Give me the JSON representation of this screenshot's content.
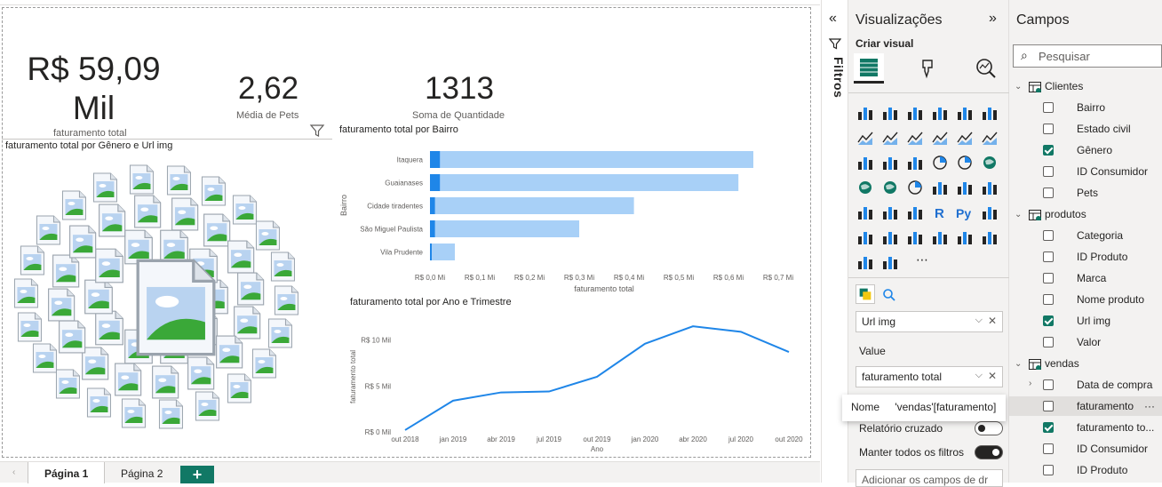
{
  "kpis": {
    "revenue": {
      "value_line1": "R$ 59,09",
      "value_line2": "Mil",
      "caption": "faturamento total"
    },
    "pets": {
      "value": "2,62",
      "caption": "Média de Pets"
    },
    "quantity": {
      "value": "1313",
      "caption": "Soma de Quantidade"
    }
  },
  "visuals": {
    "image_title": "faturamento total por Gênero e Url img",
    "bar_title": "faturamento total por Bairro",
    "line_title": "faturamento total por Ano e Trimestre"
  },
  "chart_data": [
    {
      "type": "bar",
      "orientation": "horizontal",
      "title": "faturamento total por Bairro",
      "xlabel": "faturamento total",
      "ylabel": "Bairro",
      "categories": [
        "Itaquera",
        "Guaianases",
        "Cidade tiradentes",
        "São Miguel Paulista",
        "Vila Prudente"
      ],
      "values": [
        0.65,
        0.62,
        0.41,
        0.3,
        0.05
      ],
      "highlight_values": [
        0.02,
        0.02,
        0.01,
        0.01,
        0.0
      ],
      "unit": "R$ Mi",
      "xlim": [
        0,
        0.7
      ],
      "xticks": [
        "R$ 0,0 Mi",
        "R$ 0,1 Mi",
        "R$ 0,2 Mi",
        "R$ 0,3 Mi",
        "R$ 0,4 Mi",
        "R$ 0,5 Mi",
        "R$ 0,6 Mi",
        "R$ 0,7 Mi"
      ],
      "colors": {
        "bar": "#a8d0f7",
        "highlight": "#1f86e8"
      }
    },
    {
      "type": "line",
      "title": "faturamento total por Ano e Trimestre",
      "xlabel": "Ano",
      "ylabel": "faturamento total",
      "x": [
        "out 2018",
        "jan 2019",
        "abr 2019",
        "jul 2019",
        "out 2019",
        "jan 2020",
        "abr 2020",
        "jul 2020",
        "out 2020"
      ],
      "values": [
        0.2,
        3.4,
        4.3,
        4.4,
        6.0,
        9.6,
        11.5,
        10.9,
        8.7
      ],
      "unit": "R$ Mil",
      "ylim": [
        0,
        12
      ],
      "yticks": [
        "R$ 0 Mil",
        "R$ 5 Mil",
        "R$ 10 Mil"
      ],
      "colors": {
        "line": "#1f86e8"
      }
    }
  ],
  "tabs": {
    "prev": "‹",
    "page1": "Página 1",
    "page2": "Página 2",
    "add": "+"
  },
  "filters": {
    "collapse": "«",
    "label": "Filtros"
  },
  "viz_pane": {
    "title": "Visualizações",
    "expand": "»",
    "subtitle": "Criar visual",
    "more": "⋯",
    "wells": {
      "url_img": "Url img",
      "value_label": "Value",
      "value_field": "faturamento total"
    },
    "tooltip": {
      "key": "Nome",
      "value": "'vendas'[faturamento]"
    },
    "cross_report": "Relatório cruzado",
    "keep_filters": "Manter todos os filtros",
    "drill": "Adicionar os campos de dr"
  },
  "fields_pane": {
    "title": "Campos",
    "search_placeholder": "Pesquisar",
    "tables": [
      {
        "name": "Clientes",
        "fields": [
          {
            "label": "Bairro",
            "checked": false
          },
          {
            "label": "Estado civil",
            "checked": false
          },
          {
            "label": "Gênero",
            "checked": true
          },
          {
            "label": "ID Consumidor",
            "checked": false
          },
          {
            "label": "Pets",
            "checked": false
          }
        ]
      },
      {
        "name": "produtos",
        "fields": [
          {
            "label": "Categoria",
            "checked": false
          },
          {
            "label": "ID Produto",
            "checked": false
          },
          {
            "label": "Marca",
            "checked": false
          },
          {
            "label": "Nome produto",
            "checked": false
          },
          {
            "label": "Url img",
            "checked": true
          },
          {
            "label": "Valor",
            "checked": false
          }
        ]
      },
      {
        "name": "vendas",
        "fields": [
          {
            "label": "Data de compra",
            "checked": false
          },
          {
            "label": "faturamento",
            "checked": false
          },
          {
            "label": "faturamento to...",
            "checked": true
          },
          {
            "label": "ID Consumidor",
            "checked": false
          },
          {
            "label": "ID Produto",
            "checked": false
          }
        ]
      }
    ],
    "row_more": "···"
  }
}
